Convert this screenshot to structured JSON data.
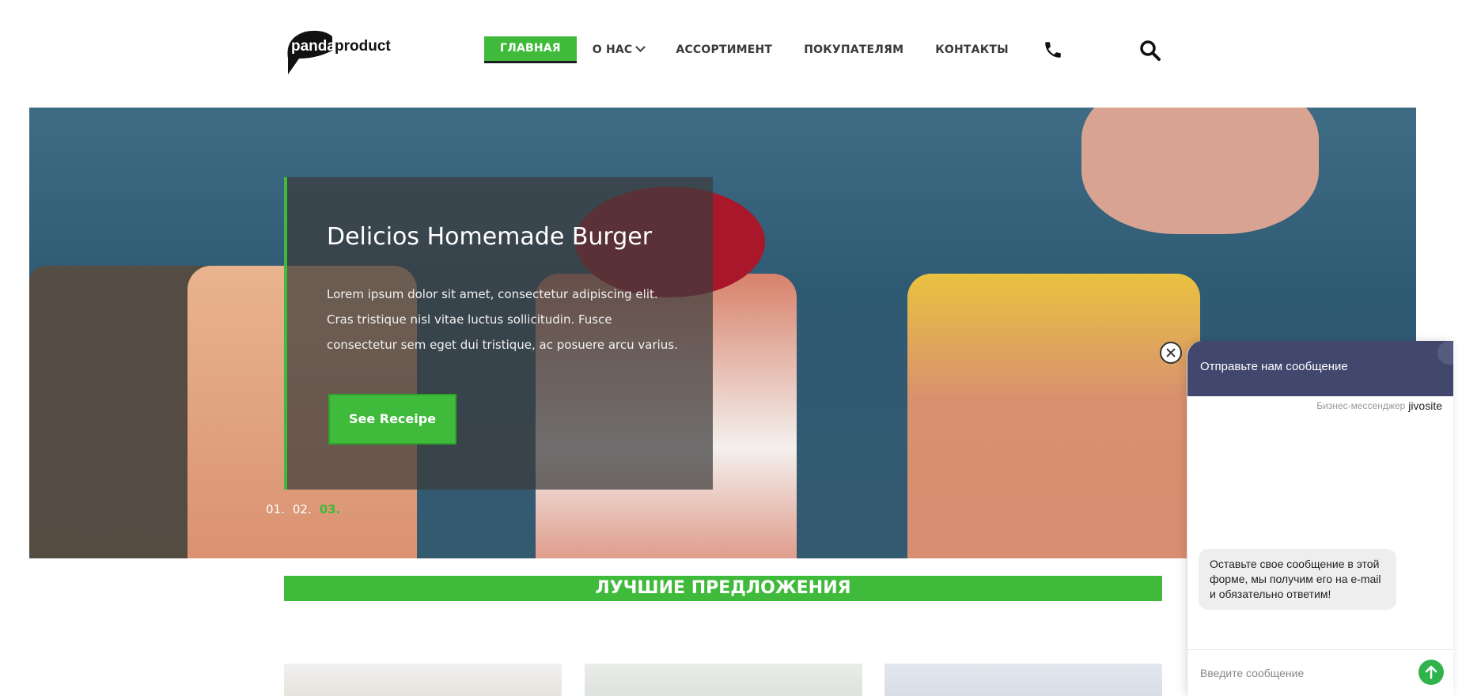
{
  "logo": {
    "text_panda": "panda",
    "text_product": "product"
  },
  "nav": {
    "items": [
      {
        "label": "ГЛАВНАЯ"
      },
      {
        "label": "О НАС"
      },
      {
        "label": "АССОРТИМЕНТ"
      },
      {
        "label": "ПОКУПАТЕЛЯМ"
      },
      {
        "label": "КОНТАКТЫ"
      }
    ],
    "icons": [
      "phone-icon",
      "search-icon",
      "chevron-down-icon"
    ]
  },
  "hero": {
    "title": "Delicios Homemade Burger",
    "text": "Lorem ipsum dolor sit amet, consectetur adipiscing elit. Cras tristique nisl vitae luctus sollicitudin. Fusce consectetur sem eget dui tristique, ac posuere arcu varius.",
    "button_label": "See Receipe",
    "slides": [
      "01.",
      "02.",
      "03."
    ],
    "active_slide": "03."
  },
  "section": {
    "title": "ЛУЧШИЕ ПРЕДЛОЖЕНИЯ"
  },
  "chat": {
    "header_title": "Отправьте нам сообщение",
    "brand_prefix": "Бизнес-мессенджер",
    "brand_name": "jivosite",
    "bubble": "Оставьте свое сообщение в этой форме, мы получим его на e-mail и обязательно ответим!",
    "input_placeholder": "Введите сообщение"
  },
  "colors": {
    "accent": "#3fba3a",
    "chat_header": "#42476d",
    "send": "#2fb34a"
  }
}
